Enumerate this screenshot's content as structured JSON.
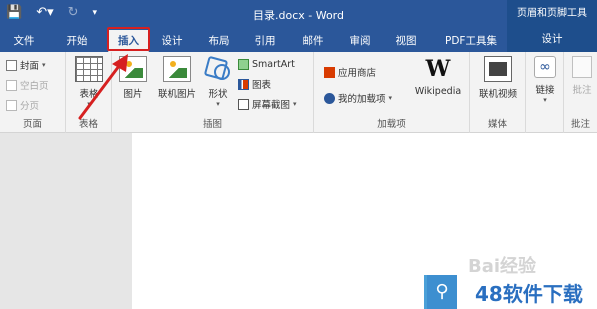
{
  "titlebar": {
    "save_icon": "save-icon",
    "undo_icon": "undo-icon",
    "redo_icon": "redo-icon",
    "customize_icon": "customize-qat-icon",
    "document_title": "目录.docx - Word",
    "context_title": "页眉和页脚工具"
  },
  "tabs": [
    {
      "label": "文件"
    },
    {
      "label": "开始"
    },
    {
      "label": "插入",
      "active": true
    },
    {
      "label": "设计"
    },
    {
      "label": "布局"
    },
    {
      "label": "引用"
    },
    {
      "label": "邮件"
    },
    {
      "label": "审阅"
    },
    {
      "label": "视图"
    },
    {
      "label": "PDF工具集"
    },
    {
      "label": "设计",
      "context": true
    }
  ],
  "ribbon": {
    "pages": {
      "label": "页面",
      "cover": "封面",
      "blank": "空白页",
      "break": "分页"
    },
    "tables": {
      "label": "表格",
      "table": "表格"
    },
    "illustrations": {
      "label": "插图",
      "picture": "图片",
      "online_picture": "联机图片",
      "shapes": "形状",
      "smartart": "SmartArt",
      "chart": "图表",
      "screenshot": "屏幕截图"
    },
    "addins": {
      "label": "加载项",
      "store": "应用商店",
      "my_addins": "我的加载项",
      "wikipedia": "Wikipedia"
    },
    "media": {
      "label": "媒体",
      "online_video": "联机视频"
    },
    "links": {
      "label": "链接"
    },
    "comments": {
      "label": "批注",
      "comment": "批注"
    }
  },
  "watermarks": {
    "baidu": "Bai经验",
    "site": "48软件下载"
  },
  "colors": {
    "word_blue": "#2b579a",
    "highlight_red": "#d62020"
  }
}
